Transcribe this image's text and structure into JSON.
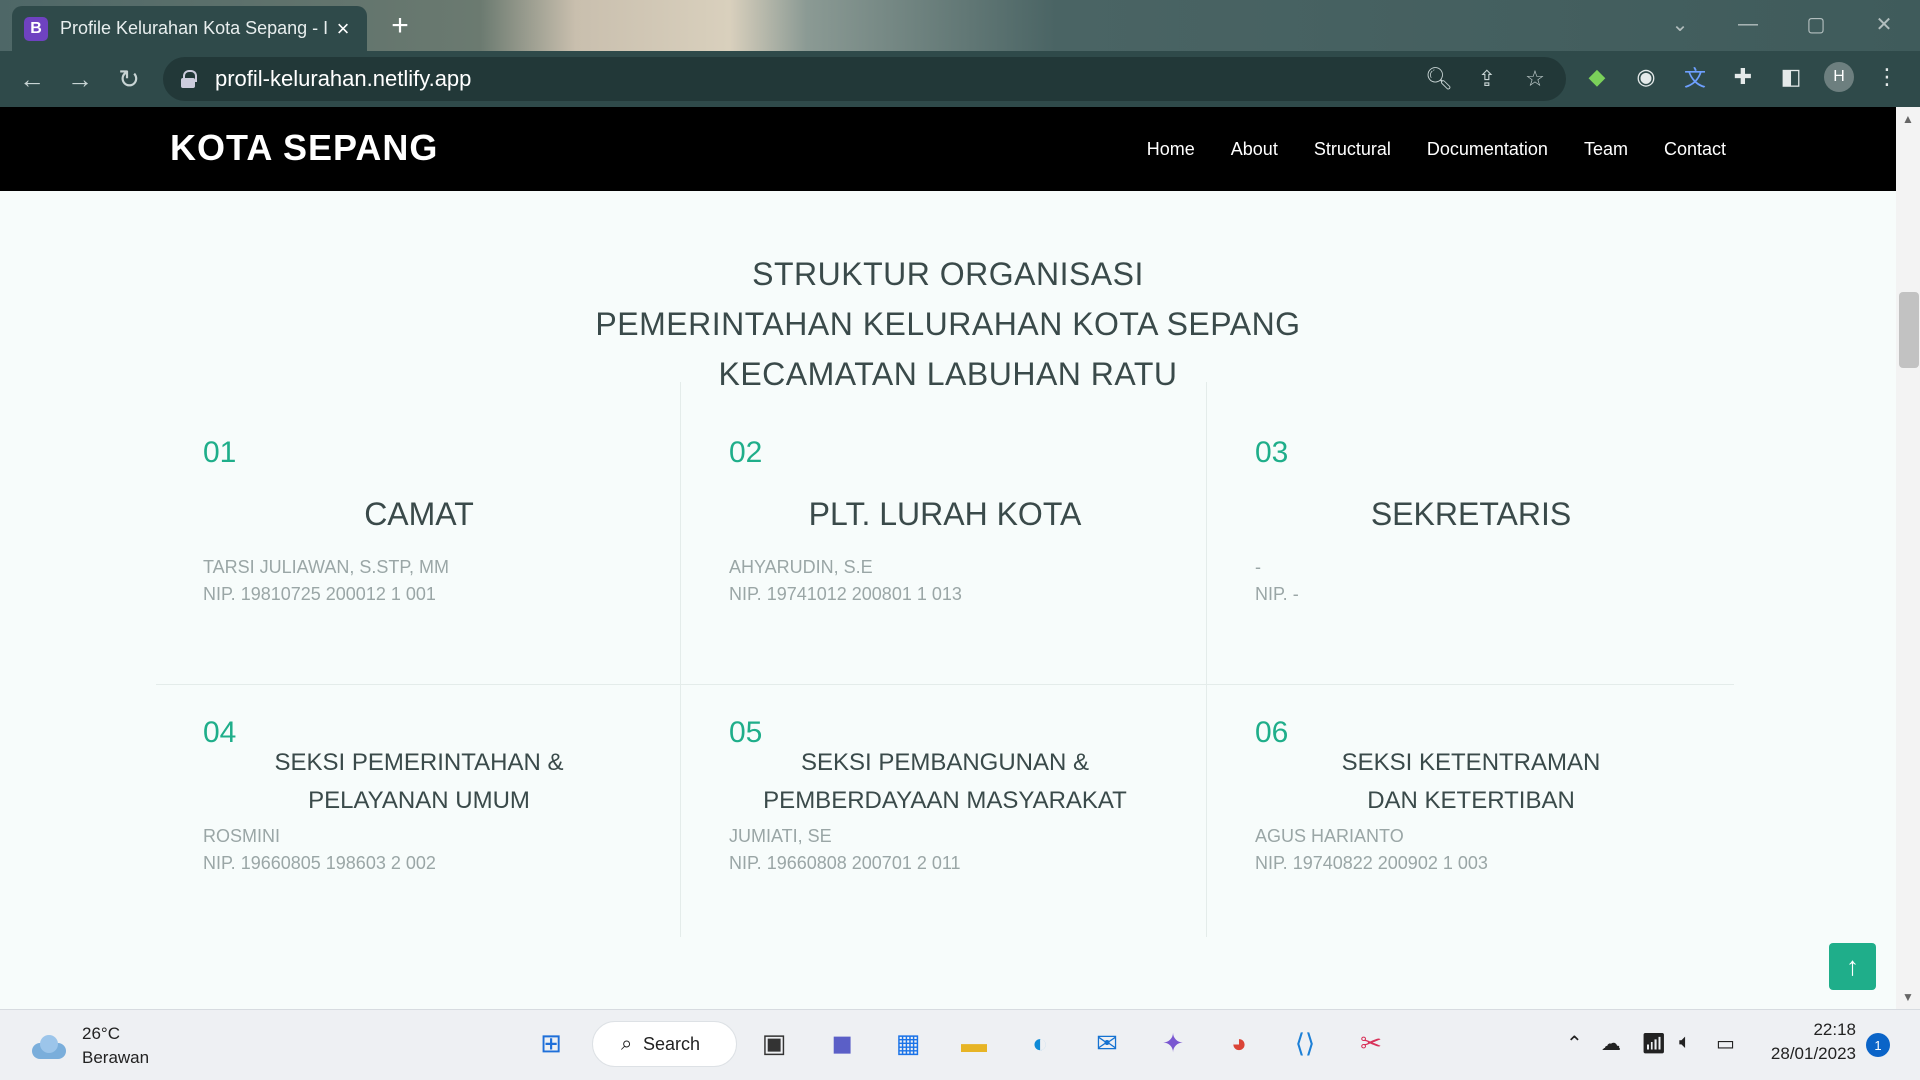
{
  "browser": {
    "tab_title": "Profile Kelurahan Kota Sepang - I",
    "tab_favicon_letter": "B",
    "url": "profil-kelurahan.netlify.app",
    "profile_initial": "H"
  },
  "site": {
    "brand": "KOTA SEPANG",
    "nav": [
      "Home",
      "About",
      "Structural",
      "Documentation",
      "Team",
      "Contact"
    ]
  },
  "structure": {
    "heading_lines": [
      "STRUKTUR ORGANISASI",
      "PEMERINTAHAN KELURAHAN KOTA SEPANG",
      "KECAMATAN LABUHAN RATU"
    ],
    "members": [
      {
        "num": "01",
        "role_lines": [
          "CAMAT"
        ],
        "name": "TARSI JULIAWAN, S.STP, MM",
        "nip": "NIP. 19810725 200012 1 001"
      },
      {
        "num": "02",
        "role_lines": [
          "PLT. LURAH KOTA"
        ],
        "name": "AHYARUDIN, S.E",
        "nip": "NIP. 19741012 200801 1 013"
      },
      {
        "num": "03",
        "role_lines": [
          "SEKRETARIS"
        ],
        "name": "-",
        "nip": "NIP. -"
      },
      {
        "num": "04",
        "role_lines": [
          "SEKSI PEMERINTAHAN &",
          "PELAYANAN UMUM"
        ],
        "name": "ROSMINI",
        "nip": "NIP. 19660805 198603 2 002"
      },
      {
        "num": "05",
        "role_lines": [
          "SEKSI PEMBANGUNAN &",
          "PEMBERDAYAAN MASYARAKAT"
        ],
        "name": "JUMIATI, SE",
        "nip": "NIP. 19660808 200701 2 011"
      },
      {
        "num": "06",
        "role_lines": [
          "SEKSI KETENTRAMAN",
          "DAN KETERTIBAN"
        ],
        "name": "AGUS HARIANTO",
        "nip": "NIP. 19740822 200902 1 003"
      }
    ]
  },
  "taskbar": {
    "weather_temp": "26°C",
    "weather_desc": "Berawan",
    "search_label": "Search",
    "time": "22:18",
    "date": "28/01/2023",
    "notification_count": "1"
  },
  "colors": {
    "accent": "#1fae8a",
    "header_bg": "#000000",
    "page_bg": "#f7fcfb"
  }
}
